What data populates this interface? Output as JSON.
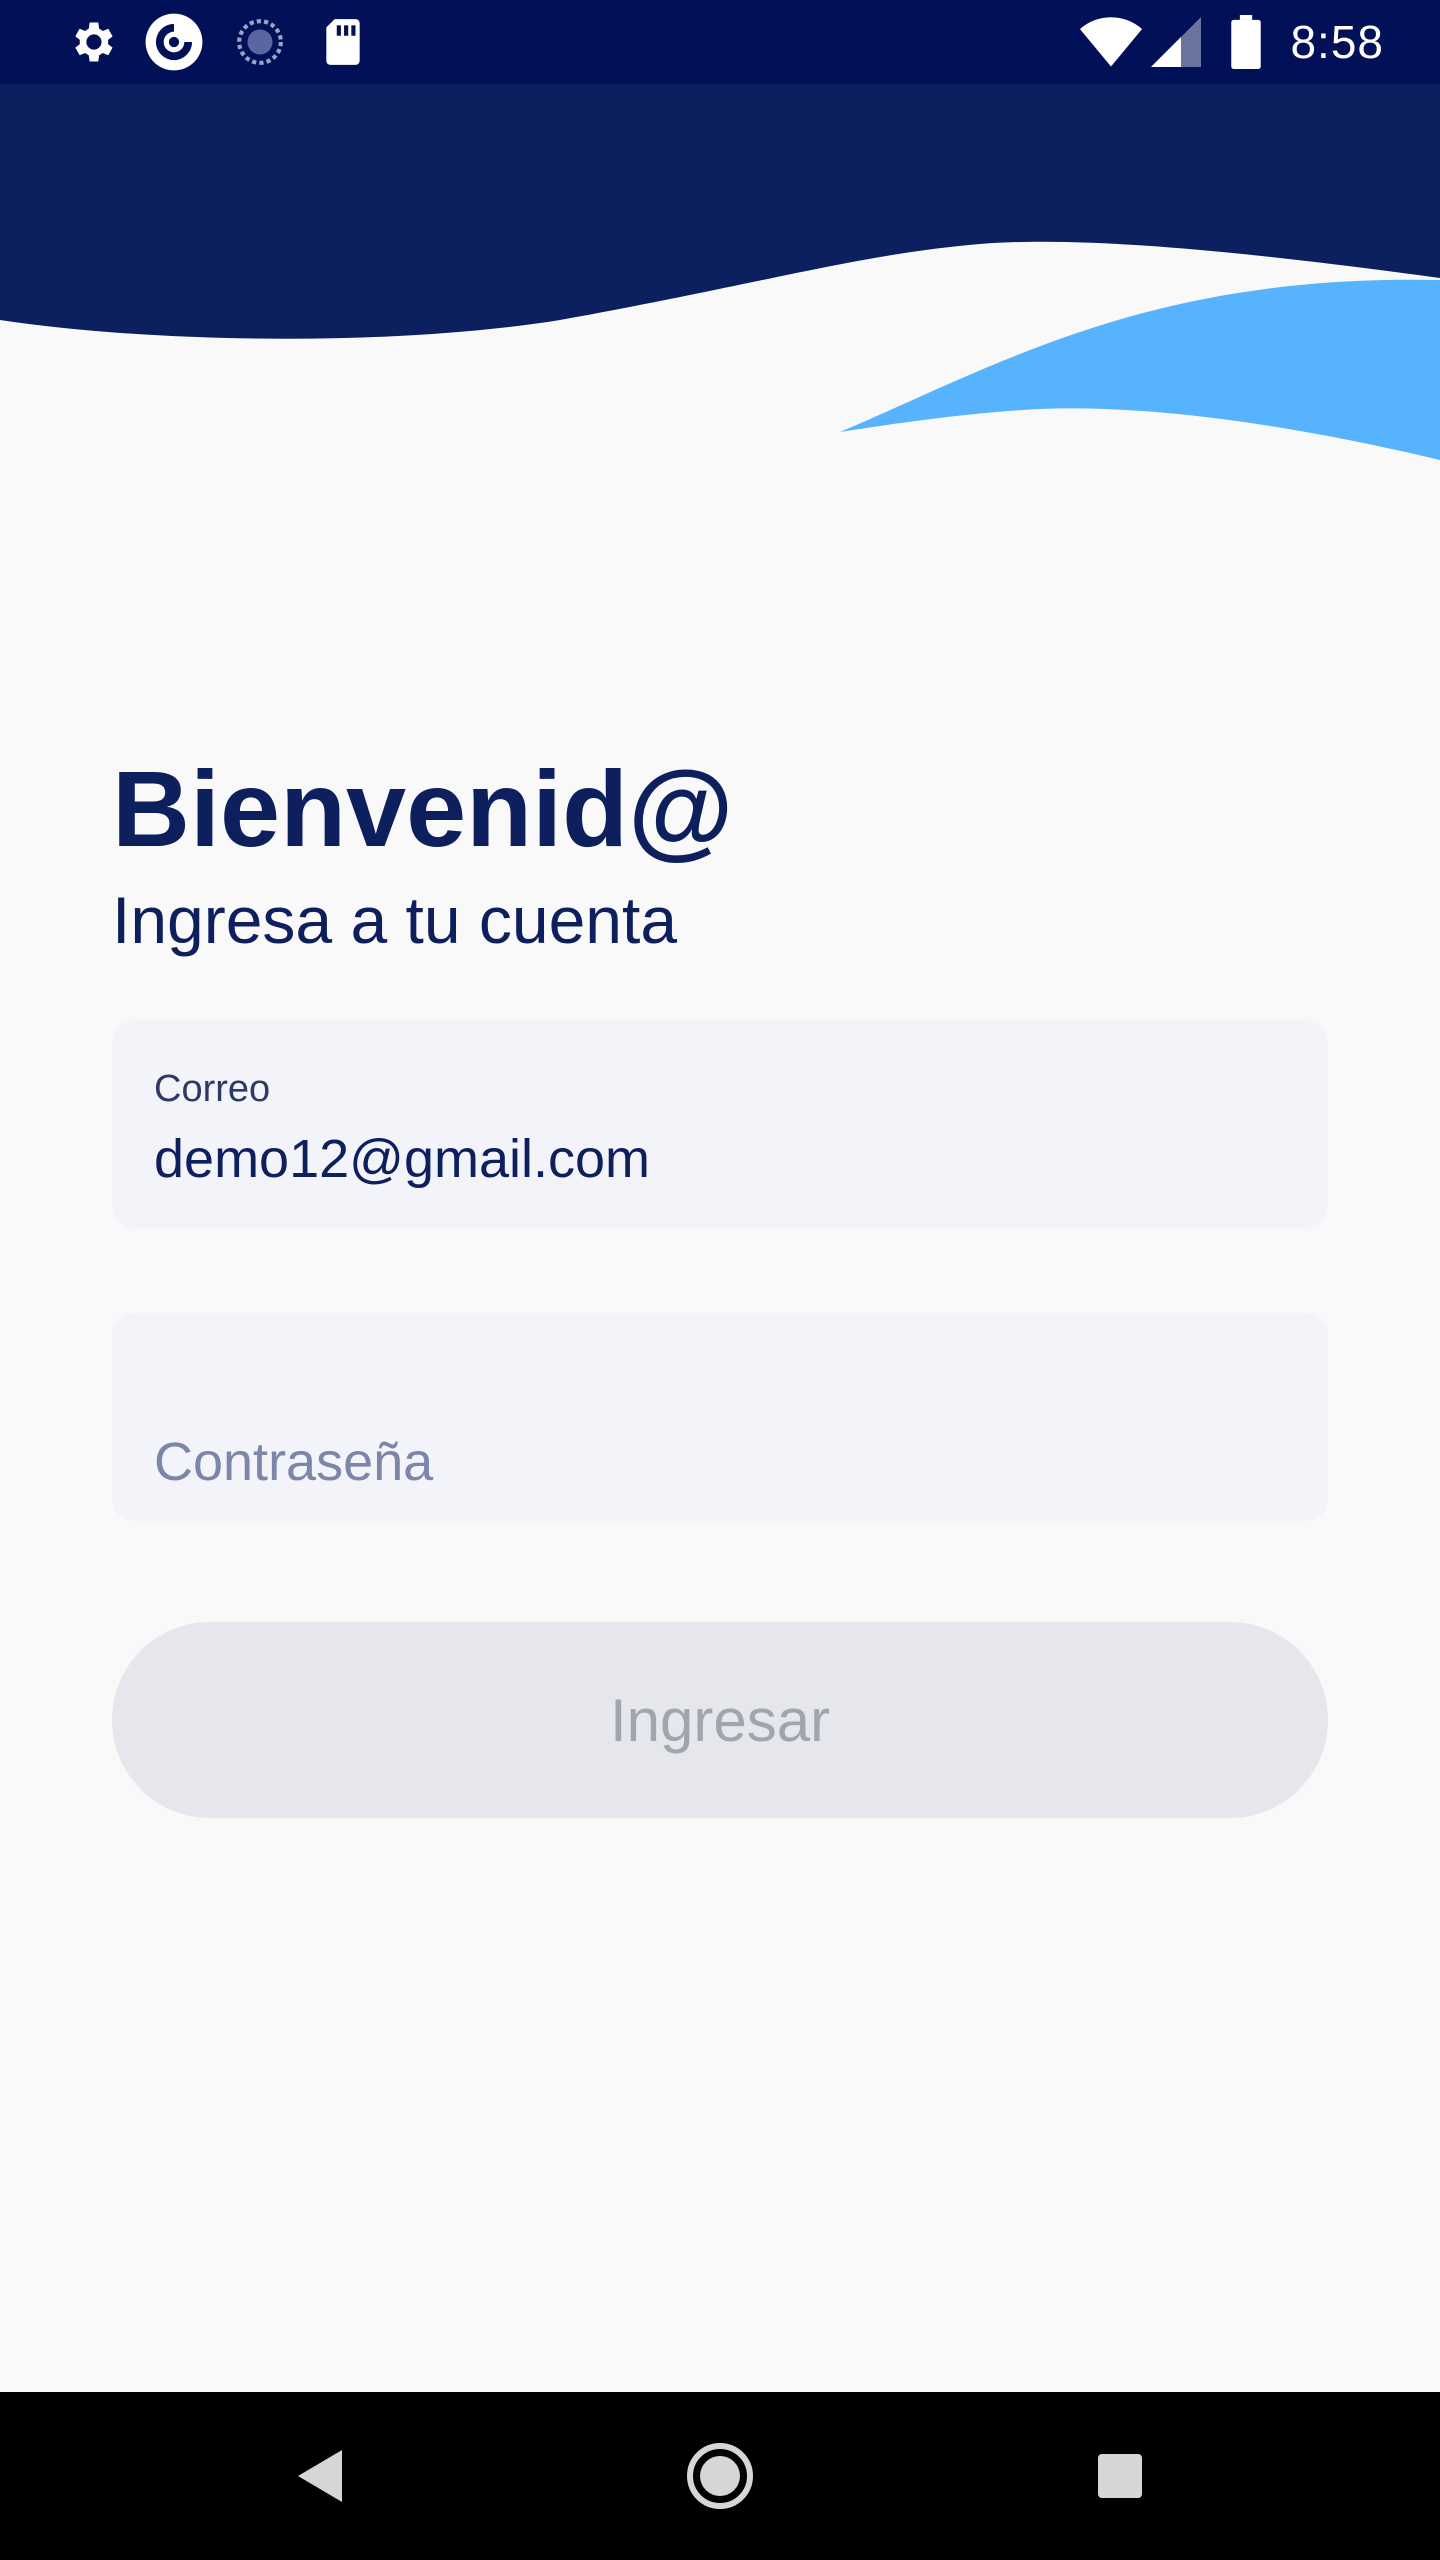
{
  "status_bar": {
    "time": "8:58",
    "icons": [
      "gear-icon",
      "app-circle-icon",
      "sync-icon",
      "sd-card-icon",
      "wifi-icon",
      "signal-icon",
      "battery-icon"
    ],
    "background": "#021157"
  },
  "header": {
    "wave_dark_color": "#0c1f5e",
    "wave_light_color": "#58b3ff"
  },
  "welcome": {
    "title": "Bienvenid@",
    "subtitle": "Ingresa a tu cuenta"
  },
  "form": {
    "email": {
      "label": "Correo",
      "value": "demo12@gmail.com"
    },
    "password": {
      "placeholder": "Contraseña",
      "value": ""
    },
    "submit_label": "Ingresar"
  },
  "nav_bar": {
    "buttons": [
      "back-icon",
      "home-icon",
      "recents-icon"
    ]
  },
  "colors": {
    "primary": "#0d1f5c",
    "accent": "#58b3ff",
    "button_disabled": "#e6e7ec"
  }
}
